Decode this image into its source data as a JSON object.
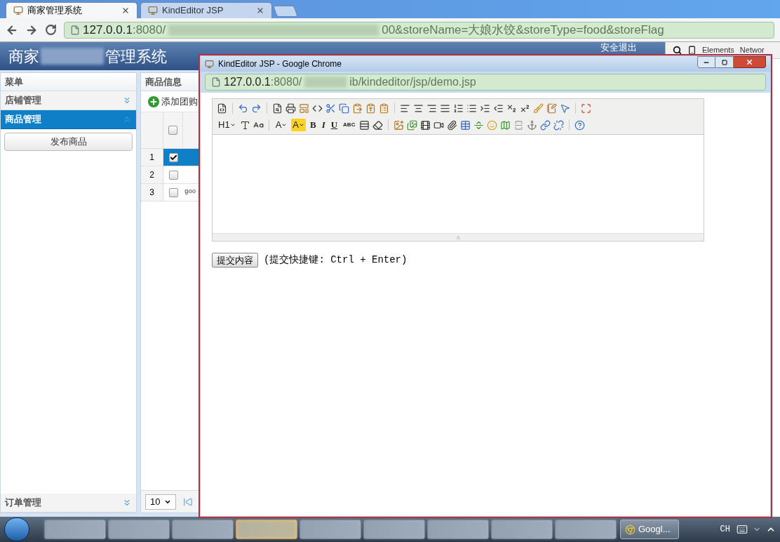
{
  "browser": {
    "tabs": [
      {
        "label": "商家管理系统",
        "selected": true
      },
      {
        "label": "KindEditor JSP",
        "selected": false
      }
    ],
    "address": {
      "host": "127.0.0.1",
      "path_start": ":8080/",
      "path_end": "00&storeName=大娘水饺&storeType=food&storeFlag"
    }
  },
  "header": {
    "title_start": "商家",
    "title_end": "管理系统",
    "logout": "安全退出"
  },
  "sidebar": {
    "title": "菜单",
    "sections": [
      {
        "label": "店铺管理",
        "expanded": false
      },
      {
        "label": "商品管理",
        "expanded": true,
        "buttons": [
          "发布商品"
        ]
      },
      {
        "label": "订单管理",
        "expanded": false
      }
    ]
  },
  "goods_panel": {
    "title": "商品信息",
    "add_button": "添加团购",
    "header_checked": false,
    "rows": [
      {
        "index": "1",
        "checked": true,
        "selected": true,
        "cell": ""
      },
      {
        "index": "2",
        "checked": false,
        "selected": false,
        "cell": ""
      },
      {
        "index": "3",
        "checked": false,
        "selected": false,
        "cell": "goo"
      }
    ],
    "page_size": "10"
  },
  "devtools": {
    "tabs": [
      "Elements",
      "Networ"
    ]
  },
  "popup": {
    "title": "KindEditor JSP - Google Chrome",
    "address": {
      "host": "127.0.0.1",
      "path_start": ":8080/",
      "path_end": "ib/kindeditor/jsp/demo.jsp"
    },
    "editor": {
      "toolbar_texts": [
        "H1",
        "A",
        "A",
        "B",
        "I",
        "U",
        "ABC"
      ]
    },
    "submit_button": "提交内容",
    "hint": "(提交快捷键: Ctrl + Enter)"
  },
  "taskbar": {
    "blurred_buttons": [
      {
        "highlighted": false
      },
      {
        "highlighted": false
      },
      {
        "highlighted": false
      },
      {
        "highlighted": true
      },
      {
        "highlighted": false
      },
      {
        "highlighted": false
      },
      {
        "highlighted": false
      },
      {
        "highlighted": false
      },
      {
        "highlighted": false
      }
    ],
    "apps": [
      {
        "label": "Googl..."
      }
    ],
    "language": "CH"
  }
}
